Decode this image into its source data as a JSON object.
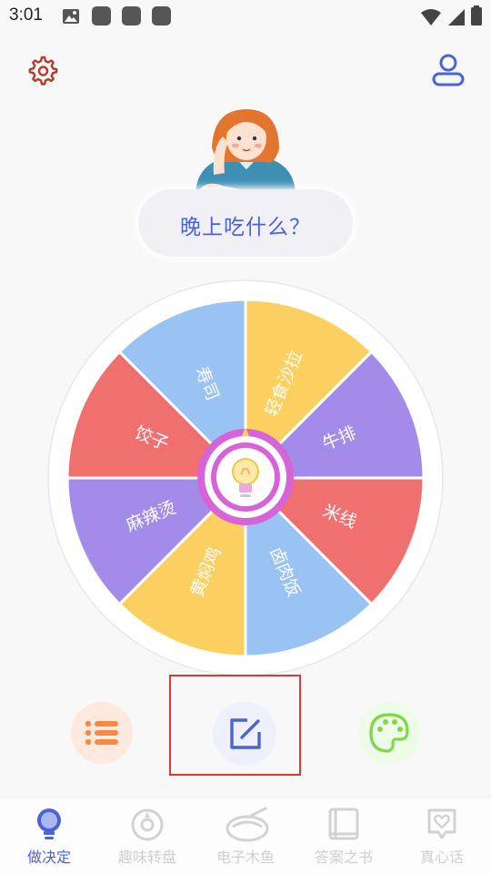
{
  "status_bar": {
    "time": "3:01"
  },
  "prompt": {
    "question": "晚上吃什么？"
  },
  "wheel": {
    "segments": [
      {
        "label": "轻食沙拉",
        "color": "#fbd060"
      },
      {
        "label": "牛排",
        "color": "#a38bea"
      },
      {
        "label": "米线",
        "color": "#f07070"
      },
      {
        "label": "卤肉饭",
        "color": "#99c3f2"
      },
      {
        "label": "黄焖鸡",
        "color": "#fbd060"
      },
      {
        "label": "麻辣烫",
        "color": "#a38bea"
      },
      {
        "label": "饺子",
        "color": "#f07070"
      },
      {
        "label": "寿司",
        "color": "#99c3f2"
      }
    ]
  },
  "tabs": [
    {
      "label": "做决定",
      "icon": "bulb-icon",
      "active": true
    },
    {
      "label": "趣味转盘",
      "icon": "wheel-icon",
      "active": false
    },
    {
      "label": "电子木鱼",
      "icon": "wooden-fish-icon",
      "active": false
    },
    {
      "label": "答案之书",
      "icon": "book-icon",
      "active": false
    },
    {
      "label": "真心话",
      "icon": "heart-chat-icon",
      "active": false
    }
  ],
  "colors": {
    "accent": "#4a63d6",
    "settings": "#b33a2f",
    "list_button": "#f58a45",
    "palette_button": "#7fd84a",
    "highlight_box": "#d83a3a",
    "hub": "#d664d6"
  }
}
